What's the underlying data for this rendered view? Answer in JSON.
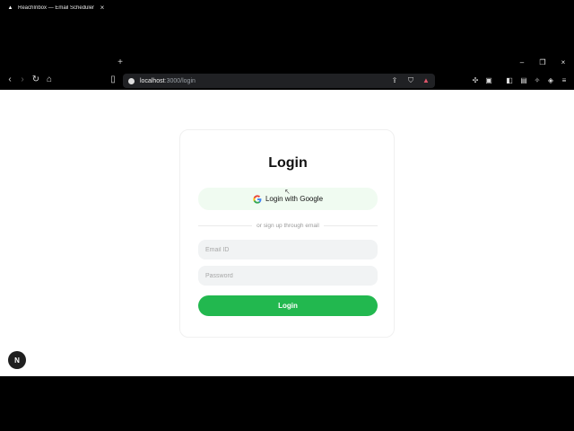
{
  "browser": {
    "tab_title": "ReachInbox — Email Scheduler",
    "tab_close": "×",
    "new_tab": "+",
    "url_host": "localhost",
    "url_path": ":3000/login",
    "window_controls": [
      "–",
      "❐",
      "×"
    ]
  },
  "login": {
    "heading": "Login",
    "google_label": "Login with Google",
    "divider_text": "or sign up through email",
    "email_placeholder": "Email ID",
    "email_value": "",
    "password_placeholder": "Password",
    "password_value": "",
    "submit_label": "Login"
  },
  "dev_badge": "N",
  "colors": {
    "accent": "#22b84f",
    "google_button_bg": "#f0fbf1",
    "input_bg": "#f1f3f4"
  }
}
